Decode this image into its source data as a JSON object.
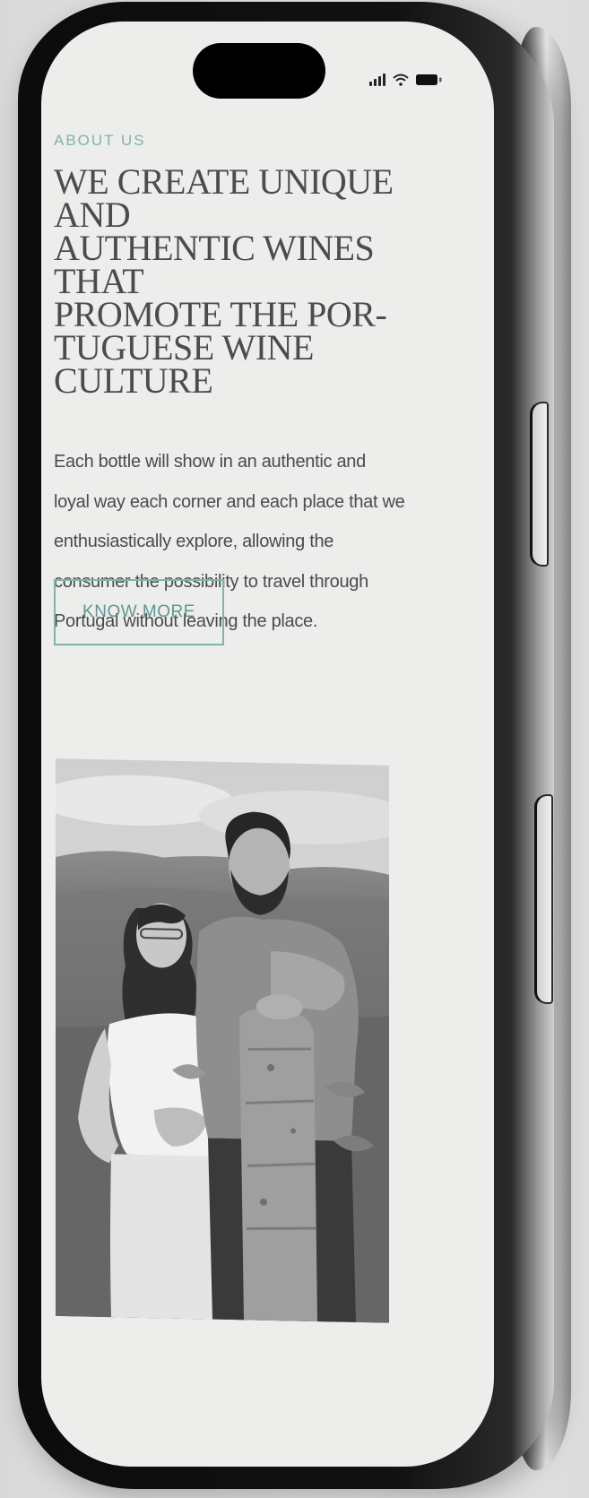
{
  "status_bar": {
    "signal_icon": "signal-bars-icon",
    "wifi_icon": "wifi-icon",
    "battery_icon": "battery-icon"
  },
  "about": {
    "eyebrow": "ABOUT US",
    "headline_lines": [
      "WE CREATE UNIQUE AND",
      "AUTHENTIC WINES THAT",
      "PROMOTE THE POR-",
      "TUGUESE WINE CULTURE"
    ],
    "body_lines": [
      "Each bottle will show in an authentic and",
      "loyal way each corner and each place that we",
      "enthusiastically explore, allowing the",
      "consumer the possibility to travel through",
      "Portugal without leaving the place."
    ],
    "cta_label": "KNOW MORE"
  },
  "photo": {
    "subject": "Black-and-white photo of a smiling couple standing beside a granite post in a vineyard"
  },
  "colors": {
    "accent": "#7fb4ad",
    "headline": "#4a4c4d",
    "body": "#4b4b4b",
    "screen_bg": "#ededec"
  }
}
